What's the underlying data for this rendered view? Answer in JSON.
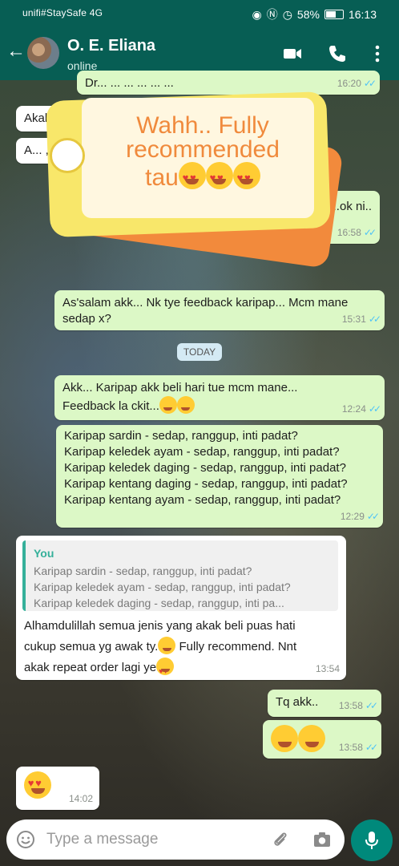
{
  "status_bar": {
    "carrier": "unifi#StaySafe",
    "network": "4G",
    "battery": "58%",
    "time": "16:13"
  },
  "header": {
    "contact_name": "O. E. Eliana",
    "contact_status": "online",
    "icons": [
      "back-arrow-icon",
      "video-call-icon",
      "voice-call-icon",
      "more-options-icon"
    ]
  },
  "sticker": {
    "lines": [
      "Wahh.. Fully",
      "recommended",
      "tau"
    ]
  },
  "messages": {
    "m0": {
      "text": "Dr... ... ... ... ... ...",
      "time": "16:20"
    },
    "m1": {
      "text": "Akak ...",
      "time": ""
    },
    "m2": {
      "text": "A... , x dp...",
      "time": ""
    },
    "m3": {
      "text": "...ok ni..",
      "time": "16:58"
    },
    "m4": {
      "line1": "As'salam akk... Nk tye feedback karipap... Mcm mane",
      "line2": "sedap x?",
      "time": "15:31"
    },
    "date_chip": "TODAY",
    "m5": {
      "line1": "Akk... Karipap akk beli hari tue mcm mane...",
      "line2": "Feedback la ckit...",
      "time": "12:24"
    },
    "m6": {
      "lines": [
        "Karipap sardin - sedap, ranggup, inti padat?",
        "Karipap keledek ayam - sedap, ranggup, inti padat?",
        "Karipap keledek daging - sedap, ranggup, inti padat?",
        "Karipap kentang daging - sedap, ranggup, inti padat?",
        "Karipap kentang ayam - sedap, ranggup, inti padat?"
      ],
      "time": "12:29"
    },
    "m7": {
      "quote_author": "You",
      "quote_lines": [
        "Karipap sardin - sedap, ranggup, inti padat?",
        "Karipap keledek ayam - sedap, ranggup, inti padat?",
        "Karipap keledek daging - sedap, ranggup, inti pa..."
      ],
      "line1": "Alhamdulillah semua jenis yang akak beli puas hati",
      "line2a": "cukup semua yg awak ty.",
      "line2b": " Fully recommend. Nnt",
      "line3": "akak repeat order lagi ye",
      "time": "13:54"
    },
    "m8": {
      "text": "Tq akk..",
      "time": "13:58"
    },
    "m9": {
      "time": "13:58"
    },
    "m10": {
      "time": "14:02"
    }
  },
  "input": {
    "placeholder": "Type a message",
    "icons": [
      "emoji-icon",
      "attach-icon",
      "camera-icon",
      "mic-icon"
    ]
  },
  "colors": {
    "header": "#075e54",
    "outgoing_bubble": "#dcf8c6",
    "incoming_bubble": "#ffffff",
    "read_ticks": "#4fc3f7",
    "mic_button": "#00897b"
  }
}
